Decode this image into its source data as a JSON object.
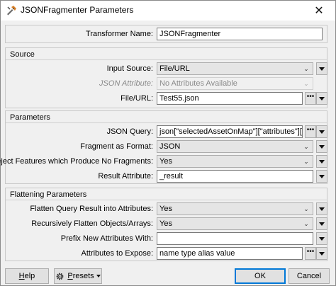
{
  "window": {
    "title": "JSONFragmenter Parameters",
    "close": "✕"
  },
  "transformer": {
    "label": "Transformer Name:",
    "value": "JSONFragmenter"
  },
  "source": {
    "title": "Source",
    "input_source": {
      "label": "Input Source:",
      "value": "File/URL"
    },
    "json_attribute": {
      "label": "JSON Attribute:",
      "value": "No Attributes Available"
    },
    "file_url": {
      "label": "File/URL:",
      "value": "Test55.json"
    }
  },
  "parameters": {
    "title": "Parameters",
    "json_query": {
      "label": "JSON Query:",
      "value": "json[\"selectedAssetOnMap\"][\"attributes\"][*]"
    },
    "fragment_as": {
      "label": "Fragment as Format:",
      "value": "JSON"
    },
    "reject": {
      "label": "Reject Features which Produce No Fragments:",
      "value": "Yes"
    },
    "result_attr": {
      "label": "Result Attribute:",
      "value": "_result"
    }
  },
  "flattening": {
    "title": "Flattening Parameters",
    "flatten_query": {
      "label": "Flatten Query Result into Attributes:",
      "value": "Yes"
    },
    "recursive": {
      "label": "Recursively Flatten Objects/Arrays:",
      "value": "Yes"
    },
    "prefix": {
      "label": "Prefix New Attributes With:",
      "value": ""
    },
    "expose": {
      "label": "Attributes to Expose:",
      "value": "name type alias value"
    }
  },
  "buttons": {
    "help_h": "H",
    "help_rest": "elp",
    "presets_p": "P",
    "presets_rest": "resets",
    "ok": "OK",
    "cancel": "Cancel"
  }
}
